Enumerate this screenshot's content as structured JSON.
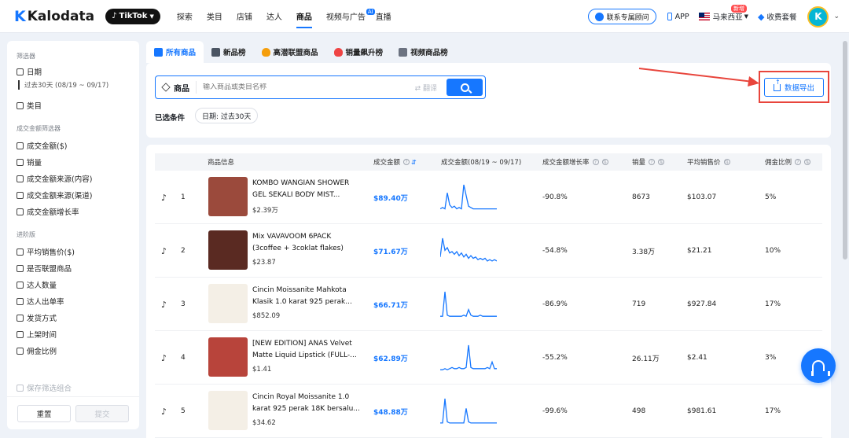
{
  "brand": {
    "name": "Kalodata"
  },
  "platform": {
    "label": "TikTok"
  },
  "nav": [
    {
      "label": "探索"
    },
    {
      "label": "类目"
    },
    {
      "label": "店铺"
    },
    {
      "label": "达人"
    },
    {
      "label": "商品",
      "active": true
    },
    {
      "label": "视频与广告",
      "badge": "AI",
      "suffix": "直播"
    }
  ],
  "topbar": {
    "consult": "联系专属顾问",
    "app": "APP",
    "region": "马来西亚",
    "region_tag": "新增",
    "pricing": "收费套餐",
    "avatar_letter": "K"
  },
  "sidebar": {
    "filter_title": "筛选器",
    "date_label": "日期",
    "date_value": "过去30天 (08/19 ~ 09/17)",
    "category_label": "类目",
    "gmv_group": "成交金额筛选器",
    "gmv_items": [
      "成交金额($)",
      "销量",
      "成交金额来源(内容)",
      "成交金额来源(渠道)",
      "成交金额增长率"
    ],
    "advanced_group": "进阶版",
    "advanced_items": [
      "平均销售价($)",
      "是否联盟商品",
      "达人数量",
      "达人出单率",
      "发货方式",
      "上架时间",
      "佣金比例"
    ],
    "save_label": "保存筛选组合",
    "reset_label": "重置",
    "submit_label": "提交"
  },
  "tabs": [
    {
      "label": "所有商品",
      "active": true
    },
    {
      "label": "新品榜"
    },
    {
      "label": "高潜联盟商品"
    },
    {
      "label": "销量飙升榜"
    },
    {
      "label": "视频商品榜"
    }
  ],
  "search": {
    "scope_label": "商品",
    "placeholder": "输入商品或类目名称",
    "translate": "翻译"
  },
  "conditions": {
    "label": "已选条件",
    "chip": "日期: 过去30天"
  },
  "export": {
    "label": "数据导出"
  },
  "table": {
    "headers": {
      "product": "商品信息",
      "gmv": "成交金额",
      "gmv_trend": "成交金额(08/19 ~ 09/17)",
      "growth": "成交金额增长率",
      "sales": "销量",
      "avg_price": "平均销售价",
      "commission": "佣金比例"
    },
    "rows": [
      {
        "rank": "1",
        "name": "KOMBO WANGIAN SHOWER GEL SEKALI BODY MIST...",
        "price": "$2.39万",
        "gmv": "$89.40万",
        "growth": "-90.8%",
        "sales": "8673",
        "avg_price": "$103.07",
        "commission": "5%",
        "thumb": "#9b4a3c",
        "trend": [
          2,
          3,
          2,
          14,
          5,
          3,
          4,
          2,
          3,
          2,
          20,
          12,
          4,
          3,
          2,
          2,
          2,
          2,
          2,
          2,
          2,
          2,
          2,
          2,
          2
        ]
      },
      {
        "rank": "2",
        "name": "Mix VAVAVOOM 6PACK (3coffee + 3coklat flakes)",
        "price": "$23.87",
        "gmv": "$71.67万",
        "growth": "-54.8%",
        "sales": "3.38万",
        "avg_price": "$21.21",
        "commission": "10%",
        "thumb": "#5a2a22",
        "trend": [
          6,
          20,
          11,
          13,
          9,
          10,
          8,
          10,
          7,
          9,
          6,
          8,
          5,
          7,
          5,
          6,
          4,
          5,
          4,
          5,
          3,
          4,
          3,
          4,
          3
        ]
      },
      {
        "rank": "3",
        "name": "Cincin Moissanite Mahkota Klasik 1.0 karat 925 perak...",
        "price": "$852.09",
        "gmv": "$66.71万",
        "growth": "-86.9%",
        "sales": "719",
        "avg_price": "$927.84",
        "commission": "17%",
        "thumb": "#f4efe6",
        "trend": [
          2,
          2,
          24,
          3,
          2,
          2,
          2,
          2,
          2,
          2,
          3,
          2,
          8,
          3,
          2,
          2,
          2,
          3,
          2,
          2,
          2,
          2,
          2,
          2,
          2
        ]
      },
      {
        "rank": "4",
        "name": "[NEW EDITION] ANAS Velvet Matte Liquid Lipstick (FULL-...",
        "price": "$1.41",
        "gmv": "$62.89万",
        "growth": "-55.2%",
        "sales": "26.11万",
        "avg_price": "$2.41",
        "commission": "3%",
        "thumb": "#b8443b",
        "trend": [
          2,
          2,
          3,
          2,
          3,
          4,
          3,
          3,
          4,
          3,
          3,
          4,
          24,
          4,
          3,
          3,
          3,
          3,
          3,
          3,
          4,
          3,
          9,
          3,
          3
        ]
      },
      {
        "rank": "5",
        "name": "Cincin Royal Moissanite 1.0 karat 925 perak 18K bersalu...",
        "price": "$34.62",
        "gmv": "$48.88万",
        "growth": "-99.6%",
        "sales": "498",
        "avg_price": "$981.61",
        "commission": "17%",
        "thumb": "#f4efe6",
        "trend": [
          2,
          2,
          22,
          3,
          2,
          2,
          2,
          2,
          2,
          2,
          2,
          14,
          3,
          2,
          2,
          2,
          2,
          2,
          2,
          2,
          2,
          2,
          2,
          2,
          2
        ]
      }
    ]
  },
  "colors": {
    "accent": "#1677ff",
    "highlight": "#e8453c"
  }
}
